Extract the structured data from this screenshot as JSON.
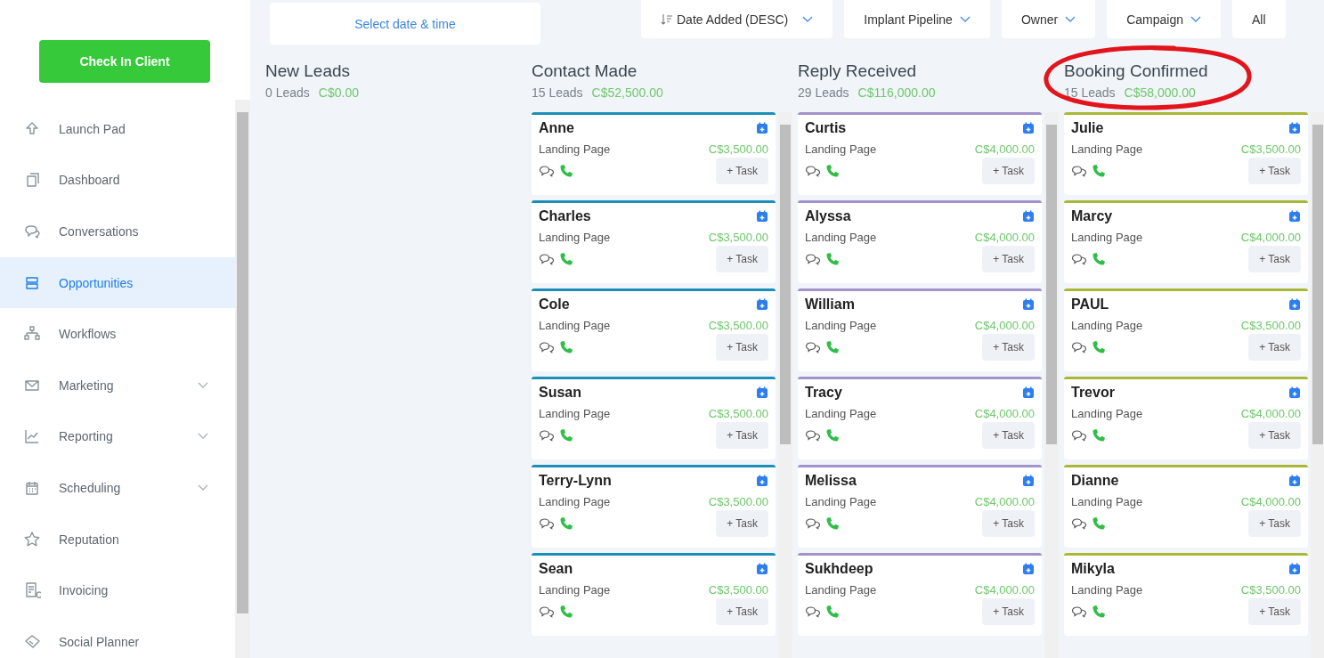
{
  "sidebar": {
    "check_in_button": "Check In Client",
    "items": [
      {
        "label": "Launch Pad",
        "selected": false,
        "expandable": false
      },
      {
        "label": "Dashboard",
        "selected": false,
        "expandable": false
      },
      {
        "label": "Conversations",
        "selected": false,
        "expandable": false
      },
      {
        "label": "Opportunities",
        "selected": true,
        "expandable": false
      },
      {
        "label": "Workflows",
        "selected": false,
        "expandable": false
      },
      {
        "label": "Marketing",
        "selected": false,
        "expandable": true
      },
      {
        "label": "Reporting",
        "selected": false,
        "expandable": true
      },
      {
        "label": "Scheduling",
        "selected": false,
        "expandable": true
      },
      {
        "label": "Reputation",
        "selected": false,
        "expandable": false
      },
      {
        "label": "Invoicing",
        "selected": false,
        "expandable": false
      },
      {
        "label": "Social Planner",
        "selected": false,
        "expandable": false
      }
    ]
  },
  "filters": {
    "date": {
      "placeholder": "Select date & time"
    },
    "dropdowns": [
      {
        "label": "Date Added (DESC)",
        "kind": "sort"
      },
      {
        "label": "Implant Pipeline",
        "kind": "select"
      },
      {
        "label": "Owner",
        "kind": "select"
      },
      {
        "label": "Campaign",
        "kind": "select"
      },
      {
        "label": "All",
        "kind": "select"
      }
    ]
  },
  "columns": [
    {
      "title": "New Leads",
      "count": "0 Leads",
      "total": "C$0.00"
    },
    {
      "title": "Contact Made",
      "count": "15 Leads",
      "total": "C$52,500.00",
      "color": "#1b8fb8",
      "cards": [
        {
          "name": "Anne",
          "source": "Landing Page",
          "value": "C$3,500.00",
          "task": "+ Task"
        },
        {
          "name": "Charles",
          "source": "Landing Page",
          "value": "C$3,500.00",
          "task": "+ Task"
        },
        {
          "name": "Cole",
          "source": "Landing Page",
          "value": "C$3,500.00",
          "task": "+ Task"
        },
        {
          "name": "Susan",
          "source": "Landing Page",
          "value": "C$3,500.00",
          "task": "+ Task"
        },
        {
          "name": "Terry-Lynn",
          "source": "Landing Page",
          "value": "C$3,500.00",
          "task": "+ Task"
        },
        {
          "name": "Sean",
          "source": "Landing Page",
          "value": "C$3,500.00",
          "task": "+ Task"
        }
      ]
    },
    {
      "title": "Reply Received",
      "count": "29 Leads",
      "total": "C$116,000.00",
      "color": "#a393cc",
      "cards": [
        {
          "name": "Curtis",
          "source": "Landing Page",
          "value": "C$4,000.00",
          "task": "+ Task"
        },
        {
          "name": "Alyssa",
          "source": "Landing Page",
          "value": "C$4,000.00",
          "task": "+ Task"
        },
        {
          "name": "William",
          "source": "Landing Page",
          "value": "C$4,000.00",
          "task": "+ Task"
        },
        {
          "name": "Tracy",
          "source": "Landing Page",
          "value": "C$4,000.00",
          "task": "+ Task"
        },
        {
          "name": "Melissa",
          "source": "Landing Page",
          "value": "C$4,000.00",
          "task": "+ Task"
        },
        {
          "name": "Sukhdeep",
          "source": "Landing Page",
          "value": "C$4,000.00",
          "task": "+ Task"
        }
      ]
    },
    {
      "title": "Booking Confirmed",
      "count": "15 Leads",
      "total": "C$58,000.00",
      "color": "#a9b936",
      "cards": [
        {
          "name": "Julie",
          "source": "Landing Page",
          "value": "C$3,500.00",
          "task": "+ Task"
        },
        {
          "name": "Marcy",
          "source": "Landing Page",
          "value": "C$4,000.00",
          "task": "+ Task"
        },
        {
          "name": "PAUL",
          "source": "Landing Page",
          "value": "C$3,500.00",
          "task": "+ Task"
        },
        {
          "name": "Trevor",
          "source": "Landing Page",
          "value": "C$4,000.00",
          "task": "+ Task"
        },
        {
          "name": "Dianne",
          "source": "Landing Page",
          "value": "C$4,000.00",
          "task": "+ Task"
        },
        {
          "name": "Mikyla",
          "source": "Landing Page",
          "value": "C$3,500.00",
          "task": "+ Task"
        }
      ]
    }
  ]
}
